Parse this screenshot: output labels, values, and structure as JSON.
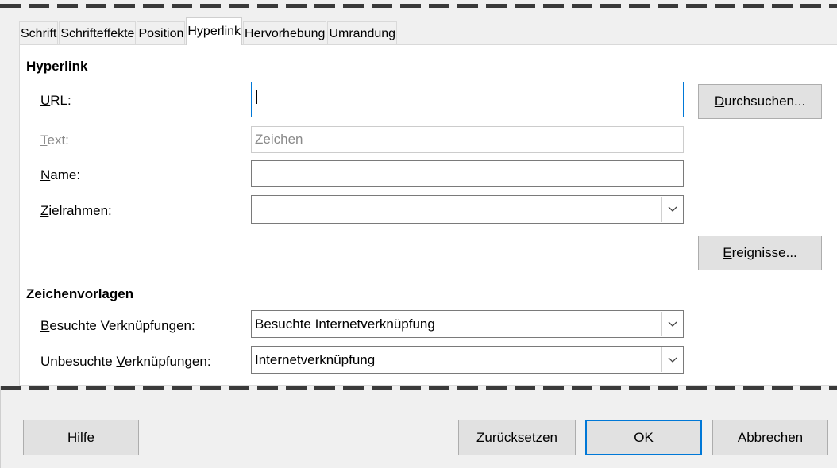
{
  "tabs": [
    {
      "label": "Schrift"
    },
    {
      "label": "Schrifteffekte"
    },
    {
      "label": "Position"
    },
    {
      "label": "Hyperlink"
    },
    {
      "label": "Hervorhebung"
    },
    {
      "label": "Umrandung"
    }
  ],
  "active_tab": "Hyperlink",
  "hyperlink": {
    "heading": "Hyperlink",
    "url_label": "URL:",
    "url_value": "",
    "text_label": "Text:",
    "text_value": "Zeichen",
    "name_label": "Name:",
    "name_value": "",
    "target_label": "Zielrahmen:",
    "target_value": "",
    "browse_button": "Durchsuchen...",
    "events_button": "Ereignisse..."
  },
  "charstyles": {
    "heading": "Zeichenvorlagen",
    "visited_label": "Besuchte Verknüpfungen:",
    "visited_value": "Besuchte Internetverknüpfung",
    "unvisited_label": "Unbesuchte Verknüpfungen:",
    "unvisited_value": "Internetverknüpfung"
  },
  "footer": {
    "help": "Hilfe",
    "reset": "Zurücksetzen",
    "ok": "OK",
    "cancel": "Abbrechen"
  },
  "icons": {
    "dropdown": "chevron-down-icon"
  },
  "colors": {
    "focus": "#0078d7",
    "tear_line": "#3a3a3a"
  }
}
